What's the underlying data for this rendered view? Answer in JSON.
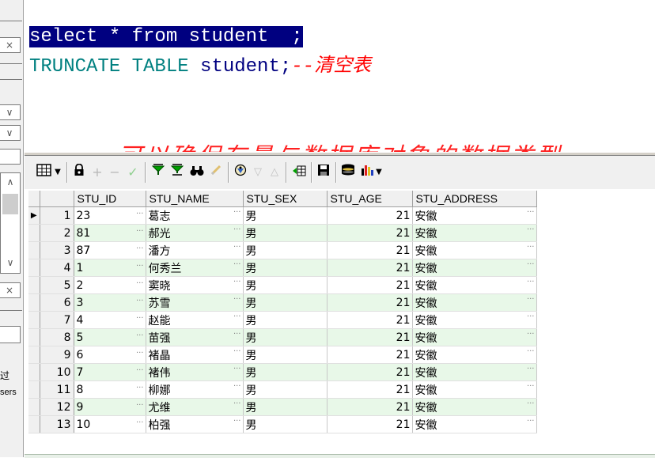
{
  "editor": {
    "line1": "select * from student  ;",
    "line2_kw": "TRUNCATE TABLE",
    "line2_id": " student;",
    "line2_comment": "--清空表",
    "faded_text": "--     可以确保存量与数据库对象的数据类型"
  },
  "toolbar": {
    "grid_icon": "grid-icon",
    "dropdown_icon": "dropdown-arrow-icon",
    "lock_icon": "lock-icon",
    "add_icon": "plus-icon",
    "remove_icon": "minus-icon",
    "post_icon": "checkmark-icon",
    "filter_icon": "filter-icon",
    "filter_clear_icon": "filter-clear-icon",
    "find_icon": "binoculars-icon",
    "clear_icon": "eraser-icon",
    "query_icon": "query-icon",
    "next_icon": "triangle-down-icon",
    "prev_icon": "triangle-up-icon",
    "export_icon": "export-icon",
    "save_icon": "save-icon",
    "db_icon": "database-icon",
    "chart_icon": "chart-icon"
  },
  "left_panel": {
    "close_label": "×",
    "chevron": "∨",
    "scroll_up": "∧",
    "scroll_down": "∨",
    "label1": "过",
    "label2": "sers"
  },
  "grid": {
    "columns": [
      "STU_ID",
      "STU_NAME",
      "STU_SEX",
      "STU_AGE",
      "STU_ADDRESS"
    ],
    "rows": [
      {
        "n": "1",
        "id": "23",
        "name": "葛志",
        "sex": "男",
        "age": "21",
        "addr": "安徽"
      },
      {
        "n": "2",
        "id": "81",
        "name": "郝光",
        "sex": "男",
        "age": "21",
        "addr": "安徽"
      },
      {
        "n": "3",
        "id": "87",
        "name": "潘方",
        "sex": "男",
        "age": "21",
        "addr": "安徽"
      },
      {
        "n": "4",
        "id": "1",
        "name": "何秀兰",
        "sex": "男",
        "age": "21",
        "addr": "安徽"
      },
      {
        "n": "5",
        "id": "2",
        "name": "窦晓",
        "sex": "男",
        "age": "21",
        "addr": "安徽"
      },
      {
        "n": "6",
        "id": "3",
        "name": "苏雪",
        "sex": "男",
        "age": "21",
        "addr": "安徽"
      },
      {
        "n": "7",
        "id": "4",
        "name": "赵能",
        "sex": "男",
        "age": "21",
        "addr": "安徽"
      },
      {
        "n": "8",
        "id": "5",
        "name": "苗强",
        "sex": "男",
        "age": "21",
        "addr": "安徽"
      },
      {
        "n": "9",
        "id": "6",
        "name": "褚晶",
        "sex": "男",
        "age": "21",
        "addr": "安徽"
      },
      {
        "n": "10",
        "id": "7",
        "name": "褚伟",
        "sex": "男",
        "age": "21",
        "addr": "安徽"
      },
      {
        "n": "11",
        "id": "8",
        "name": "柳娜",
        "sex": "男",
        "age": "21",
        "addr": "安徽"
      },
      {
        "n": "12",
        "id": "9",
        "name": "尤维",
        "sex": "男",
        "age": "21",
        "addr": "安徽"
      },
      {
        "n": "13",
        "id": "10",
        "name": "柏强",
        "sex": "男",
        "age": "21",
        "addr": "安徽"
      }
    ],
    "current_row_marker": "▶",
    "ellipsis": "···",
    "alt_row_color": "#e8f8e8"
  },
  "colors": {
    "selection": "#000080",
    "keyword": "#008080",
    "comment": "#ff0000"
  }
}
